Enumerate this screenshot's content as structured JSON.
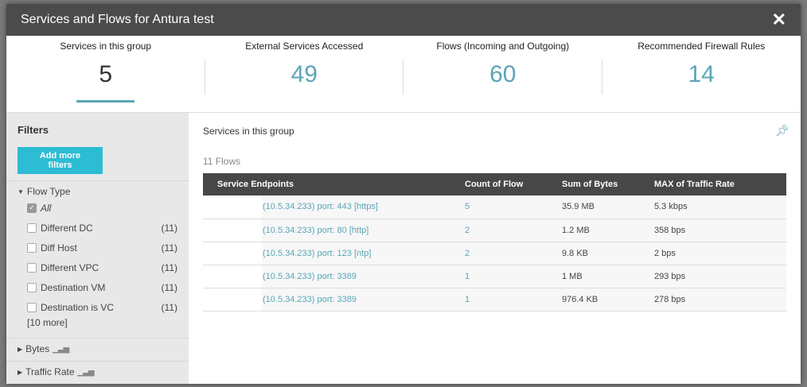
{
  "title": "Services and Flows for Antura test",
  "stats": [
    {
      "label": "Services in this group",
      "value": "5"
    },
    {
      "label": "External Services Accessed",
      "value": "49"
    },
    {
      "label": "Flows (Incoming and Outgoing)",
      "value": "60"
    },
    {
      "label": "Recommended Firewall Rules",
      "value": "14"
    }
  ],
  "filters": {
    "title": "Filters",
    "add_label": "Add more filters",
    "flow_type": "Flow Type",
    "all": "All",
    "options": [
      {
        "label": "Different DC",
        "count": "(11)"
      },
      {
        "label": "Diff Host",
        "count": "(11)"
      },
      {
        "label": "Different VPC",
        "count": "(11)"
      },
      {
        "label": "Destination VM",
        "count": "(11)"
      },
      {
        "label": "Destination is VC",
        "count": "(11)"
      }
    ],
    "more": "[10 more]",
    "bytes": "Bytes",
    "traffic_rate": "Traffic Rate"
  },
  "main": {
    "title": "Services in this group",
    "flows": "11 Flows",
    "columns": [
      "Service Endpoints",
      "Count of Flow",
      "Sum of Bytes",
      "MAX of Traffic Rate"
    ],
    "rows": [
      [
        "(10.5.34.233) port: 443 [https]",
        "5",
        "35.9 MB",
        "5.3 kbps"
      ],
      [
        "(10.5.34.233) port: 80 [http]",
        "2",
        "1.2 MB",
        "358 bps"
      ],
      [
        "(10.5.34.233) port: 123 [ntp]",
        "2",
        "9.8 KB",
        "2 bps"
      ],
      [
        "(10.5.34.233) port: 3389",
        "1",
        "1 MB",
        "293 bps"
      ],
      [
        "(10.5.34.233) port: 3389",
        "1",
        "976.4 KB",
        "278 bps"
      ]
    ]
  }
}
